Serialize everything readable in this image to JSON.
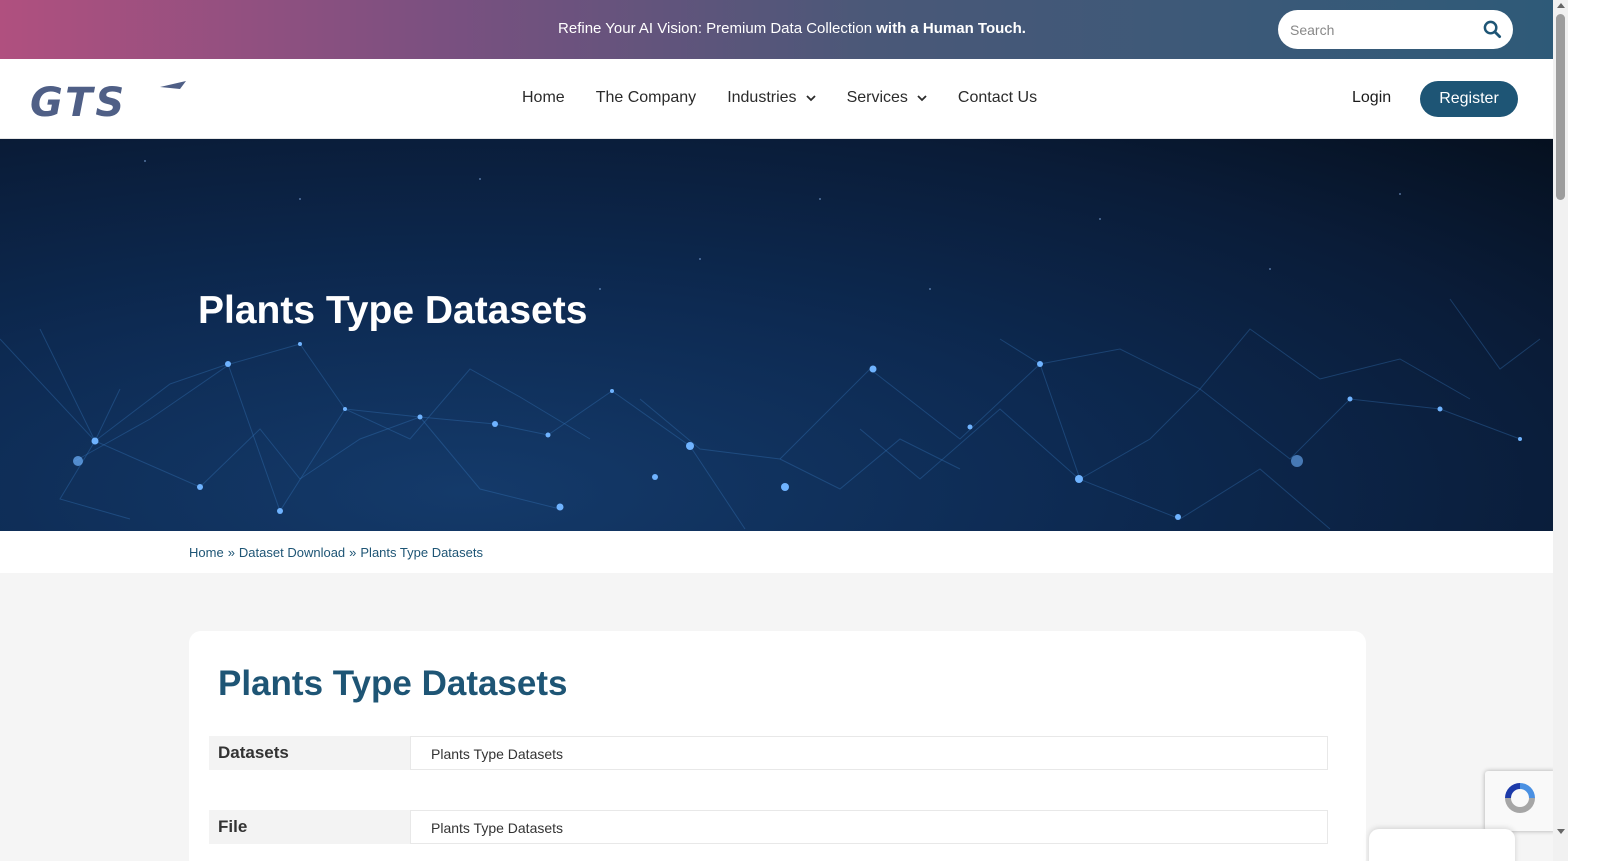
{
  "topbar": {
    "text_regular": "Refine Your AI Vision: Premium Data Collection ",
    "text_bold": "with a Human Touch.",
    "gradient_colors": [
      "#b0507f",
      "#2d5a78"
    ]
  },
  "search": {
    "placeholder": "Search",
    "value": ""
  },
  "header": {
    "logo_text": "GTS",
    "nav": [
      {
        "label": "Home",
        "has_dropdown": false
      },
      {
        "label": "The Company",
        "has_dropdown": false
      },
      {
        "label": "Industries",
        "has_dropdown": true
      },
      {
        "label": "Services",
        "has_dropdown": true
      },
      {
        "label": "Contact Us",
        "has_dropdown": false
      }
    ],
    "login_label": "Login",
    "register_label": "Register"
  },
  "hero": {
    "title": "Plants Type Datasets"
  },
  "breadcrumb": {
    "items": [
      "Home",
      "Dataset Download",
      "Plants Type Datasets"
    ],
    "separator": "»"
  },
  "card": {
    "title": "Plants Type Datasets",
    "rows": [
      {
        "label": "Datasets",
        "value": "Plants Type Datasets"
      },
      {
        "label": "File",
        "value": "Plants Type Datasets"
      }
    ]
  },
  "colors": {
    "brand": "#1e5575",
    "page_bg": "#f5f5f5"
  },
  "icons": {
    "search": "search-icon",
    "dropdown": "chevron-down-icon",
    "recaptcha": "recaptcha-icon"
  }
}
